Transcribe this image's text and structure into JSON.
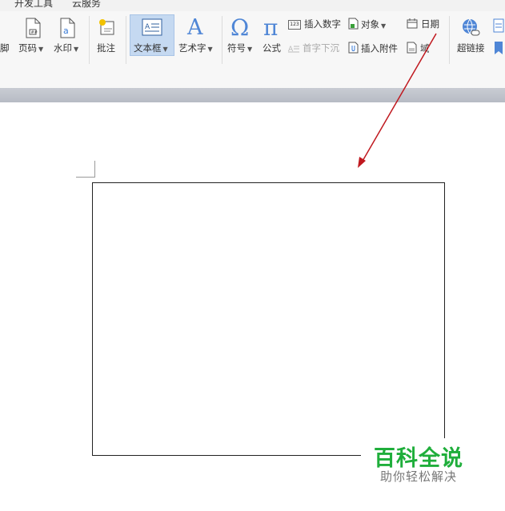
{
  "tabs": [
    "开发工具",
    "云服务"
  ],
  "ribbon": {
    "footer_partial": "脚",
    "page_number": "页码",
    "watermark": "水印",
    "comment": "批注",
    "textbox": "文本框",
    "wordart": "艺术字",
    "symbol": "符号",
    "formula": "公式",
    "insert_number": "插入数字",
    "drop_cap": "首字下沉",
    "object": "对象",
    "insert_attachment": "插入附件",
    "date": "日期",
    "field_partial": "域",
    "hyperlink": "超链接"
  },
  "watermark_brand": {
    "title": "百科全说",
    "subtitle": "助你轻松解决"
  },
  "colors": {
    "accent_arrow": "#c0191f",
    "brand_green": "#1fae3b",
    "textbox_selected_bg": "#c5d9f1"
  }
}
